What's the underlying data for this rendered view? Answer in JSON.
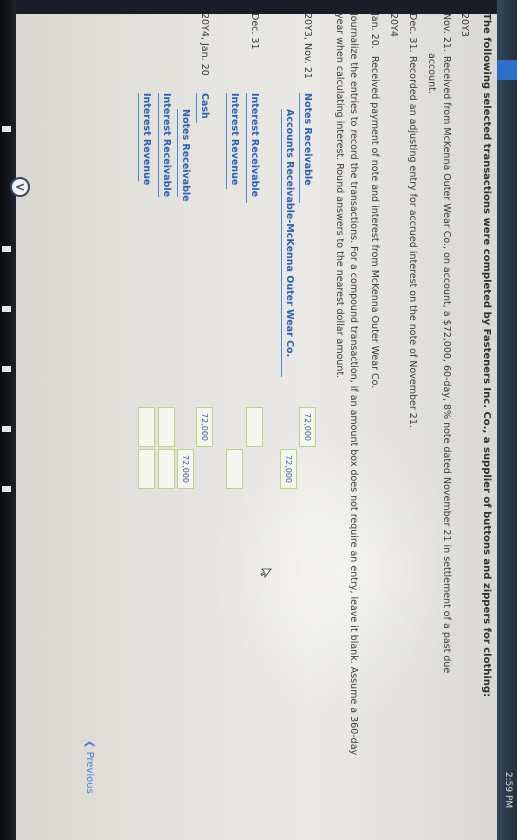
{
  "intro": "The following selected transactions were completed by Fasteners Inc. Co., a supplier of buttons and zippers for clothing:",
  "events": [
    {
      "date": "20Y3",
      "text": ""
    },
    {
      "date": "Nov. 21.",
      "text": "Received from McKenna Outer Wear Co., on account, a $72,000, 60-day, 8% note dated November 21 in settlement of a past due"
    },
    {
      "date": "",
      "text": "account."
    },
    {
      "date": "Dec. 31.",
      "text": "Recorded an adjusting entry for accrued interest on the note of November 21."
    },
    {
      "date": "20Y4",
      "text": ""
    },
    {
      "date": "Jan. 20.",
      "text": "Received payment of note and interest from McKenna Outer Wear Co."
    }
  ],
  "instructions": "Journalize the entries to record the transactions. For a compound transaction, if an amount box does not require an entry, leave it blank. Assume a 360-day year when calculating interest. Round answers to the nearest dollar amount.",
  "journal": {
    "entry1": {
      "date": "20Y3, Nov. 21",
      "debit_account": "Notes Receivable",
      "credit_account": "Accounts Receivable-McKenna Outer Wear Co.",
      "debit_amount": "72,000",
      "credit_amount": "72,000"
    },
    "entry2": {
      "date": "Dec. 31",
      "debit_account": "Interest Receivable",
      "credit_account": "Interest Revenue",
      "debit_amount": "",
      "credit_amount": ""
    },
    "entry3": {
      "date": "20Y4, Jan. 20",
      "debit_account": "Cash",
      "credit_accounts": [
        "Notes Receivable",
        "Interest Receivable",
        "Interest Revenue"
      ],
      "debit_amount": "72,000",
      "credit_amounts": [
        "72,000",
        "",
        ""
      ]
    }
  },
  "nav": {
    "previous_label": "Previous"
  },
  "taskbar": {
    "clock": "2:59 PM"
  }
}
